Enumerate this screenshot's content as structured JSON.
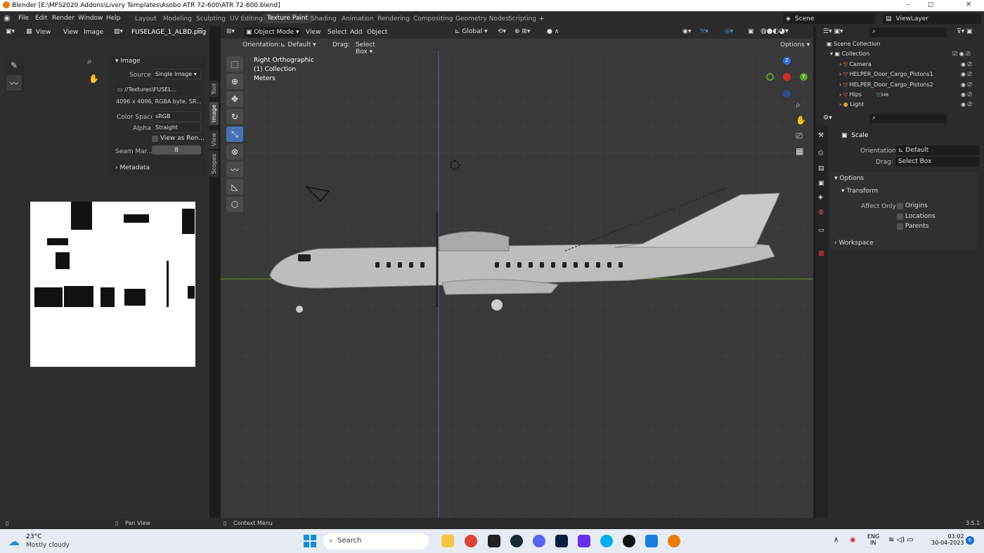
{
  "title_bar": {
    "title": "Blender [E:\\MFS2020 Addons\\Livery Templates\\Asobo ATR 72-600\\ATR 72-600.blend]",
    "minimize": "–",
    "maximize": "◻",
    "close": "✕"
  },
  "menu": {
    "items": [
      "File",
      "Edit",
      "Render",
      "Window",
      "Help"
    ]
  },
  "workspaces": {
    "tabs": [
      "Layout",
      "Modeling",
      "Sculpting",
      "UV Editing",
      "Texture Paint",
      "Shading",
      "Animation",
      "Rendering",
      "Compositing",
      "Geometry Nodes",
      "Scripting"
    ],
    "active": "Texture Paint",
    "add": "+"
  },
  "scene": {
    "label": "Scene",
    "view_layer": "ViewLayer"
  },
  "image_editor": {
    "view": "View",
    "view2": "View",
    "image": "Image",
    "image_name": "FUSELAGE_1_ALBD.png",
    "panel_title": "Image",
    "source_label": "Source",
    "source_value": "Single Image",
    "path": "//Textures\\FUSEL...",
    "info": "4096 x 4096,  RGBA byte, SR...",
    "color_space_label": "Color Space",
    "color_space_value": "sRGB",
    "alpha_label": "Alpha",
    "alpha_value": "Straight",
    "view_as_render": "View as Ren...",
    "seam_label": "Seam Mar...",
    "seam_value": "8",
    "metadata": "Metadata",
    "tabs": [
      "Tool",
      "Image",
      "View",
      "Scopes"
    ]
  },
  "viewport": {
    "mode": "Object Mode",
    "menus": [
      "View",
      "Select",
      "Add",
      "Object"
    ],
    "orientation_label": "Orientation:",
    "orientation_value": "Default",
    "drag_label": "Drag:",
    "drag_value": "Select Box",
    "options": "Options",
    "transform_orientation": "Global",
    "overlay_line1": "Right Orthographic",
    "overlay_line2": "(1) Collection",
    "overlay_line3": "Meters",
    "gizmo": {
      "z": "Z",
      "y": "Y"
    }
  },
  "outliner": {
    "root": "Scene Collection",
    "collection": "Collection",
    "items": [
      "Camera",
      "HELPER_Door_Cargo_Pistons1",
      "HELPER_Door_Cargo_Pistons2",
      "Hips",
      "Light"
    ],
    "hips_count": "348"
  },
  "properties": {
    "title": "Scale",
    "orientation_label": "Orientation",
    "orientation_value": "Default",
    "drag_label": "Drag:",
    "drag_value": "Select Box",
    "options": "Options",
    "transform": "Transform",
    "affect_only": "Affect Only",
    "checkboxes": [
      "Origins",
      "Locations",
      "Parents"
    ],
    "workspace": "Workspace"
  },
  "status_bar": {
    "pan": "Pan View",
    "context": "Context Menu",
    "version": "3.5.1"
  },
  "taskbar": {
    "weather_temp": "23°C",
    "weather_desc": "Mostly cloudy",
    "search": "Search",
    "lang1": "ENG",
    "lang2": "IN",
    "time": "03:02",
    "date": "30-04-2023",
    "notifications": "6"
  }
}
